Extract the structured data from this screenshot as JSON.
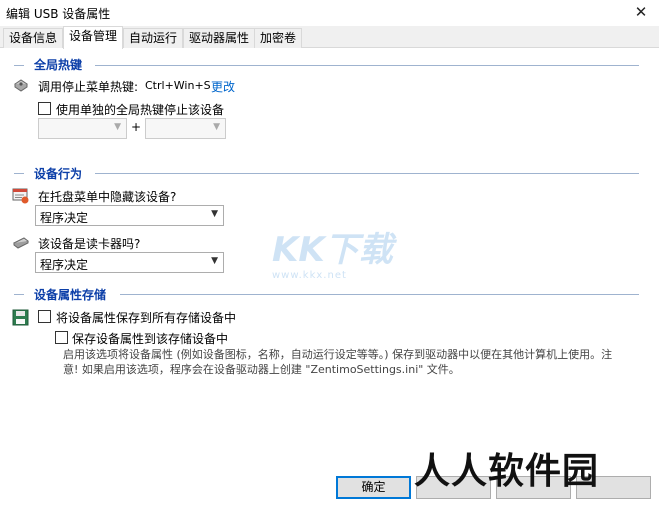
{
  "window": {
    "title": "编辑 USB 设备属性",
    "close_glyph": "✕"
  },
  "tabs": [
    {
      "label": "设备信息"
    },
    {
      "label": "设备管理"
    },
    {
      "label": "自动运行"
    },
    {
      "label": "驱动器属性"
    },
    {
      "label": "加密卷"
    }
  ],
  "hotkey": {
    "section_title": "全局热键",
    "label": "调用停止菜单热键:",
    "value": "Ctrl+Win+S",
    "change_link": "更改",
    "separate_checkbox_label": "使用单独的全局热键停止该设备",
    "separate_checked": false,
    "combo1_value": "",
    "plus": "+",
    "combo2_value": ""
  },
  "behavior": {
    "section_title": "设备行为",
    "hide_label": "在托盘菜单中隐藏该设备?",
    "hide_value": "程序决定",
    "cardreader_label": "该设备是读卡器吗?",
    "cardreader_value": "程序决定"
  },
  "storage": {
    "section_title": "设备属性存储",
    "save_all_label": "将设备属性保存到所有存储设备中",
    "save_all_checked": false,
    "save_this_label": "保存设备属性到该存储设备中",
    "save_this_checked": false,
    "description": "启用该选项将设备属性 (例如设备图标，名称，自动运行设定等等。) 保存到驱动器中以便在其他计算机上使用。注意! 如果启用该选项，程序会在设备驱动器上创建 \"ZentimoSettings.ini\" 文件。"
  },
  "buttons": {
    "ok": "确定"
  },
  "watermarks": {
    "kkx_logo": "KK下载",
    "kkx_url": "www.kkx.net",
    "renren": "人人软件园"
  },
  "colors": {
    "section_title": "#0c3fa8",
    "link": "#0066cc",
    "default_button_border": "#0078d7"
  }
}
